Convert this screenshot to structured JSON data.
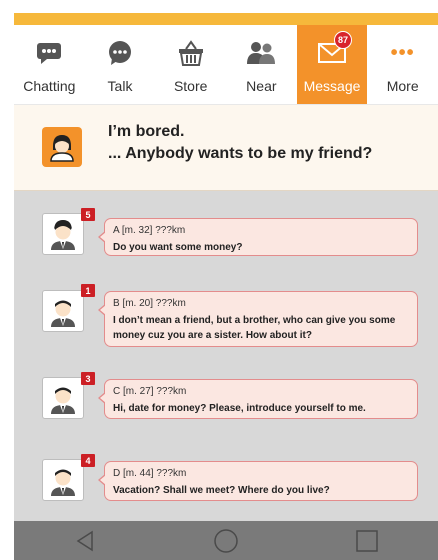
{
  "tabs": [
    {
      "label": "Chatting",
      "icon": "chatting-icon"
    },
    {
      "label": "Talk",
      "icon": "talk-icon"
    },
    {
      "label": "Store",
      "icon": "store-icon"
    },
    {
      "label": "Near",
      "icon": "near-icon"
    },
    {
      "label": "Message",
      "icon": "message-icon",
      "badge": "87",
      "active": true
    },
    {
      "label": "More",
      "icon": "more-icon"
    }
  ],
  "post": {
    "line1": "I’m bored.",
    "line2": "... Anybody wants to be my friend?"
  },
  "messages": [
    {
      "count": "5",
      "meta": "A [m. 32] ???km",
      "text": "Do you want some money?"
    },
    {
      "count": "1",
      "meta": "B [m. 20] ???km",
      "text": "I don’t mean a friend, but a brother, who can give you some money cuz you are a sister. How about it?"
    },
    {
      "count": "3",
      "meta": "C [m. 27] ???km",
      "text": "Hi, date for money? Please, introduce yourself to me."
    },
    {
      "count": "4",
      "meta": "D [m. 44] ???km",
      "text": "Vacation? Shall we meet? Where do you live?"
    }
  ],
  "colors": {
    "accent": "#f3922a",
    "topbar": "#f6b83b",
    "badge": "#d8232a",
    "bubble": "#fbe7e1"
  }
}
